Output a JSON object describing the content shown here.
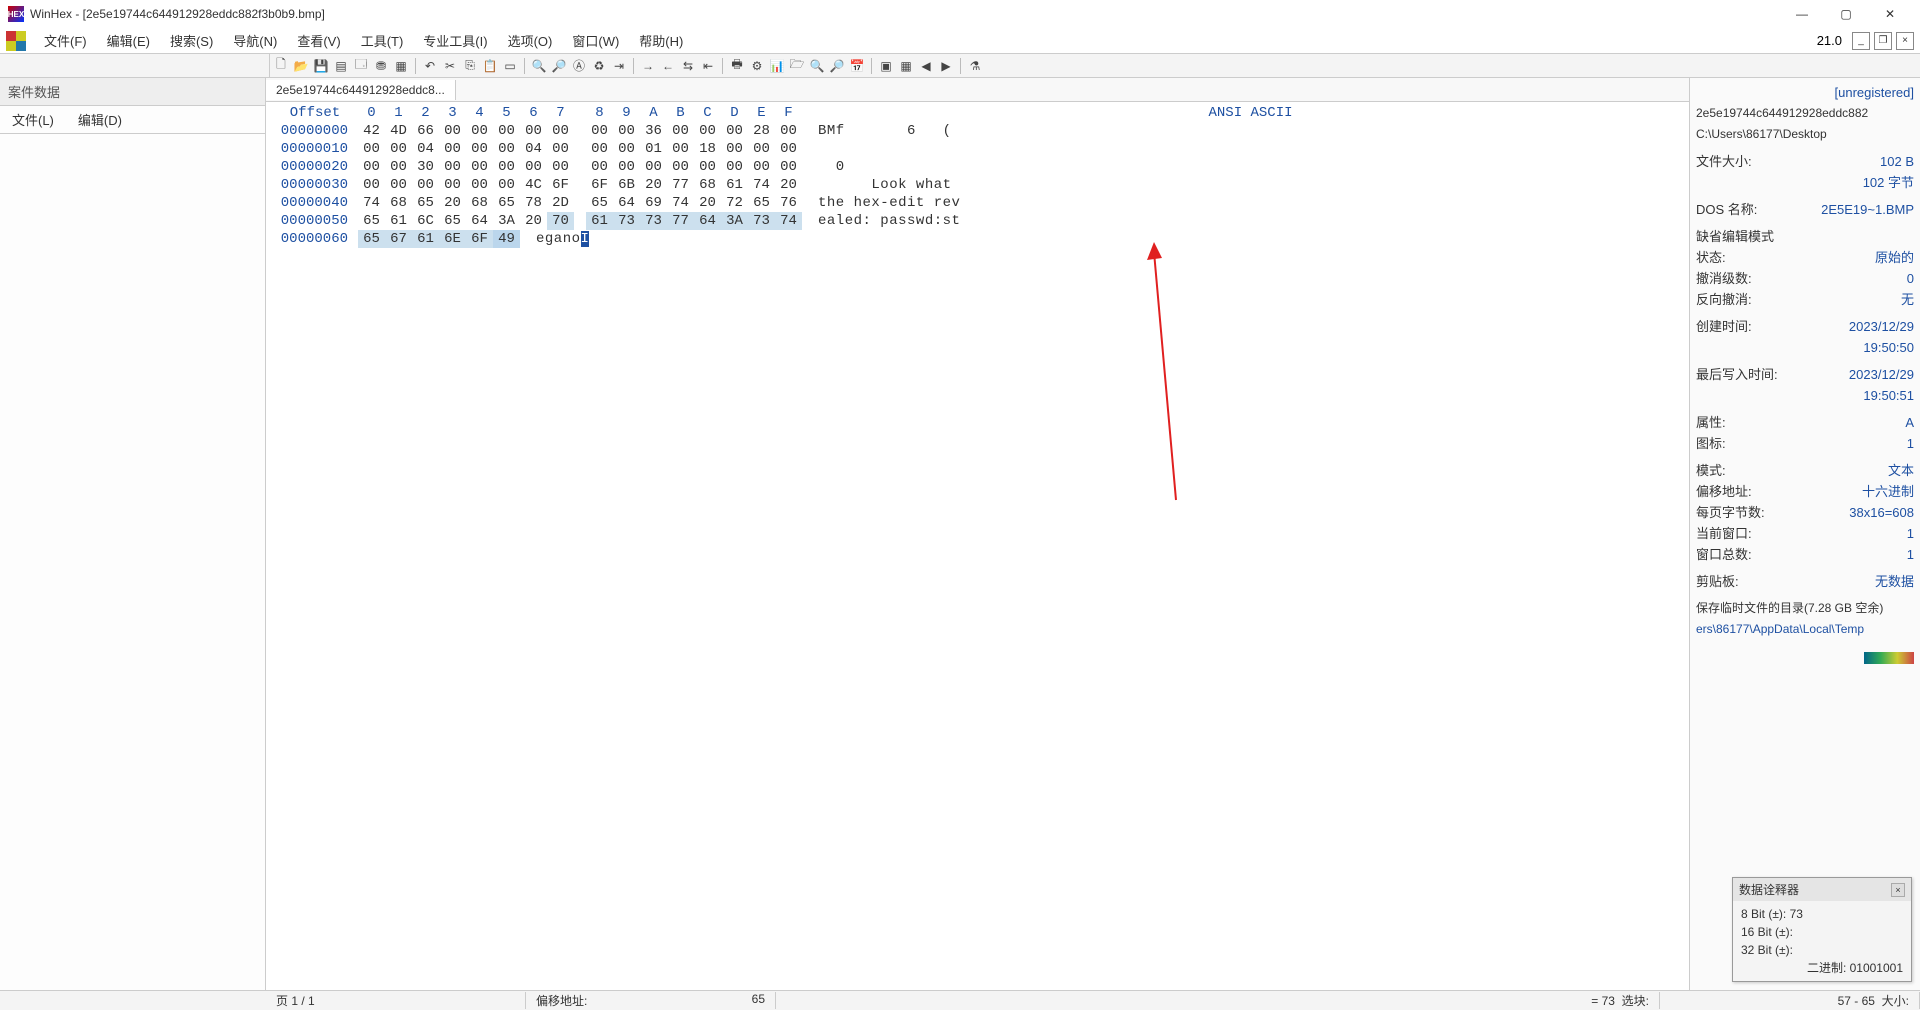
{
  "title": "WinHex - [2e5e19744c644912928eddc882f3b0b9.bmp]",
  "menu": {
    "file": "文件(F)",
    "edit": "编辑(E)",
    "search": "搜索(S)",
    "nav": "导航(N)",
    "view": "查看(V)",
    "tools": "工具(T)",
    "pro": "专业工具(I)",
    "options": "选项(O)",
    "window": "窗口(W)",
    "help": "帮助(H)",
    "version": "21.0"
  },
  "case": {
    "header": "案件数据",
    "file": "文件(L)",
    "edit": "编辑(D)"
  },
  "tab": "2e5e19744c644912928eddc8...",
  "hex": {
    "offset_label": "Offset",
    "cols": [
      "0",
      "1",
      "2",
      "3",
      "4",
      "5",
      "6",
      "7",
      "8",
      "9",
      "A",
      "B",
      "C",
      "D",
      "E",
      "F"
    ],
    "ascii_label": "ANSI ASCII",
    "rows": [
      {
        "off": "00000000",
        "b": [
          "42",
          "4D",
          "66",
          "00",
          "00",
          "00",
          "00",
          "00",
          "00",
          "00",
          "36",
          "00",
          "00",
          "00",
          "28",
          "00"
        ],
        "a": "BMf       6   ( "
      },
      {
        "off": "00000010",
        "b": [
          "00",
          "00",
          "04",
          "00",
          "00",
          "00",
          "04",
          "00",
          "00",
          "00",
          "01",
          "00",
          "18",
          "00",
          "00",
          "00"
        ],
        "a": "                "
      },
      {
        "off": "00000020",
        "b": [
          "00",
          "00",
          "30",
          "00",
          "00",
          "00",
          "00",
          "00",
          "00",
          "00",
          "00",
          "00",
          "00",
          "00",
          "00",
          "00"
        ],
        "a": "  0             "
      },
      {
        "off": "00000030",
        "b": [
          "00",
          "00",
          "00",
          "00",
          "00",
          "00",
          "4C",
          "6F",
          "6F",
          "6B",
          "20",
          "77",
          "68",
          "61",
          "74",
          "20"
        ],
        "a": "      Look what "
      },
      {
        "off": "00000040",
        "b": [
          "74",
          "68",
          "65",
          "20",
          "68",
          "65",
          "78",
          "2D",
          "65",
          "64",
          "69",
          "74",
          "20",
          "72",
          "65",
          "76"
        ],
        "a": "the hex-edit rev"
      },
      {
        "off": "00000050",
        "b": [
          "65",
          "61",
          "6C",
          "65",
          "64",
          "3A",
          "20",
          "70",
          "61",
          "73",
          "73",
          "77",
          "64",
          "3A",
          "73",
          "74"
        ],
        "a": "ealed: passwd:st"
      },
      {
        "off": "00000060",
        "b": [
          "65",
          "67",
          "61",
          "6E",
          "6F",
          "49"
        ],
        "a": "eganoI"
      }
    ]
  },
  "info": {
    "unregistered": "[unregistered]",
    "filename": "2e5e19744c644912928eddc882",
    "path": "C:\\Users\\86177\\Desktop",
    "fsize_l": "文件大小:",
    "fsize_v": "102 B",
    "fsize_v2": "102 字节",
    "dos_l": "DOS 名称:",
    "dos_v": "2E5E19~1.BMP",
    "defedit": "缺省编辑模式",
    "state_l": "状态:",
    "state_v": "原始的",
    "undo_l": "撤消级数:",
    "undo_v": "0",
    "rundo_l": "反向撤消:",
    "rundo_v": "无",
    "ctime_l": "创建时间:",
    "ctime_v": "2023/12/29",
    "ctime_v2": "19:50:50",
    "mtime_l": "最后写入时间:",
    "mtime_v": "2023/12/29",
    "mtime_v2": "19:50:51",
    "attr_l": "属性:",
    "attr_v": "A",
    "icon_l": "图标:",
    "icon_v": "1",
    "mode_l": "模式:",
    "mode_v": "文本",
    "offs_l": "偏移地址:",
    "offs_v": "十六进制",
    "bpp_l": "每页字节数:",
    "bpp_v": "38x16=608",
    "curw_l": "当前窗口:",
    "curw_v": "1",
    "winc_l": "窗口总数:",
    "winc_v": "1",
    "clip_l": "剪贴板:",
    "clip_v": "无数据",
    "temp": "保存临时文件的目录(7.28 GB 空余)",
    "temppath": "ers\\86177\\AppData\\Local\\Temp"
  },
  "interpreter": {
    "title": "数据诠释器",
    "r1": "8 Bit (±): 73",
    "r2": "16 Bit (±):",
    "r3": "32 Bit (±):",
    "r4": "二进制: 01001001"
  },
  "status": {
    "page": "页 1 / 1",
    "offset_l": "偏移地址:",
    "offset_v": "65",
    "val": "= 73",
    "sel_l": "选块:",
    "sel_v": "57 - 65",
    "size_l": "大小:"
  }
}
